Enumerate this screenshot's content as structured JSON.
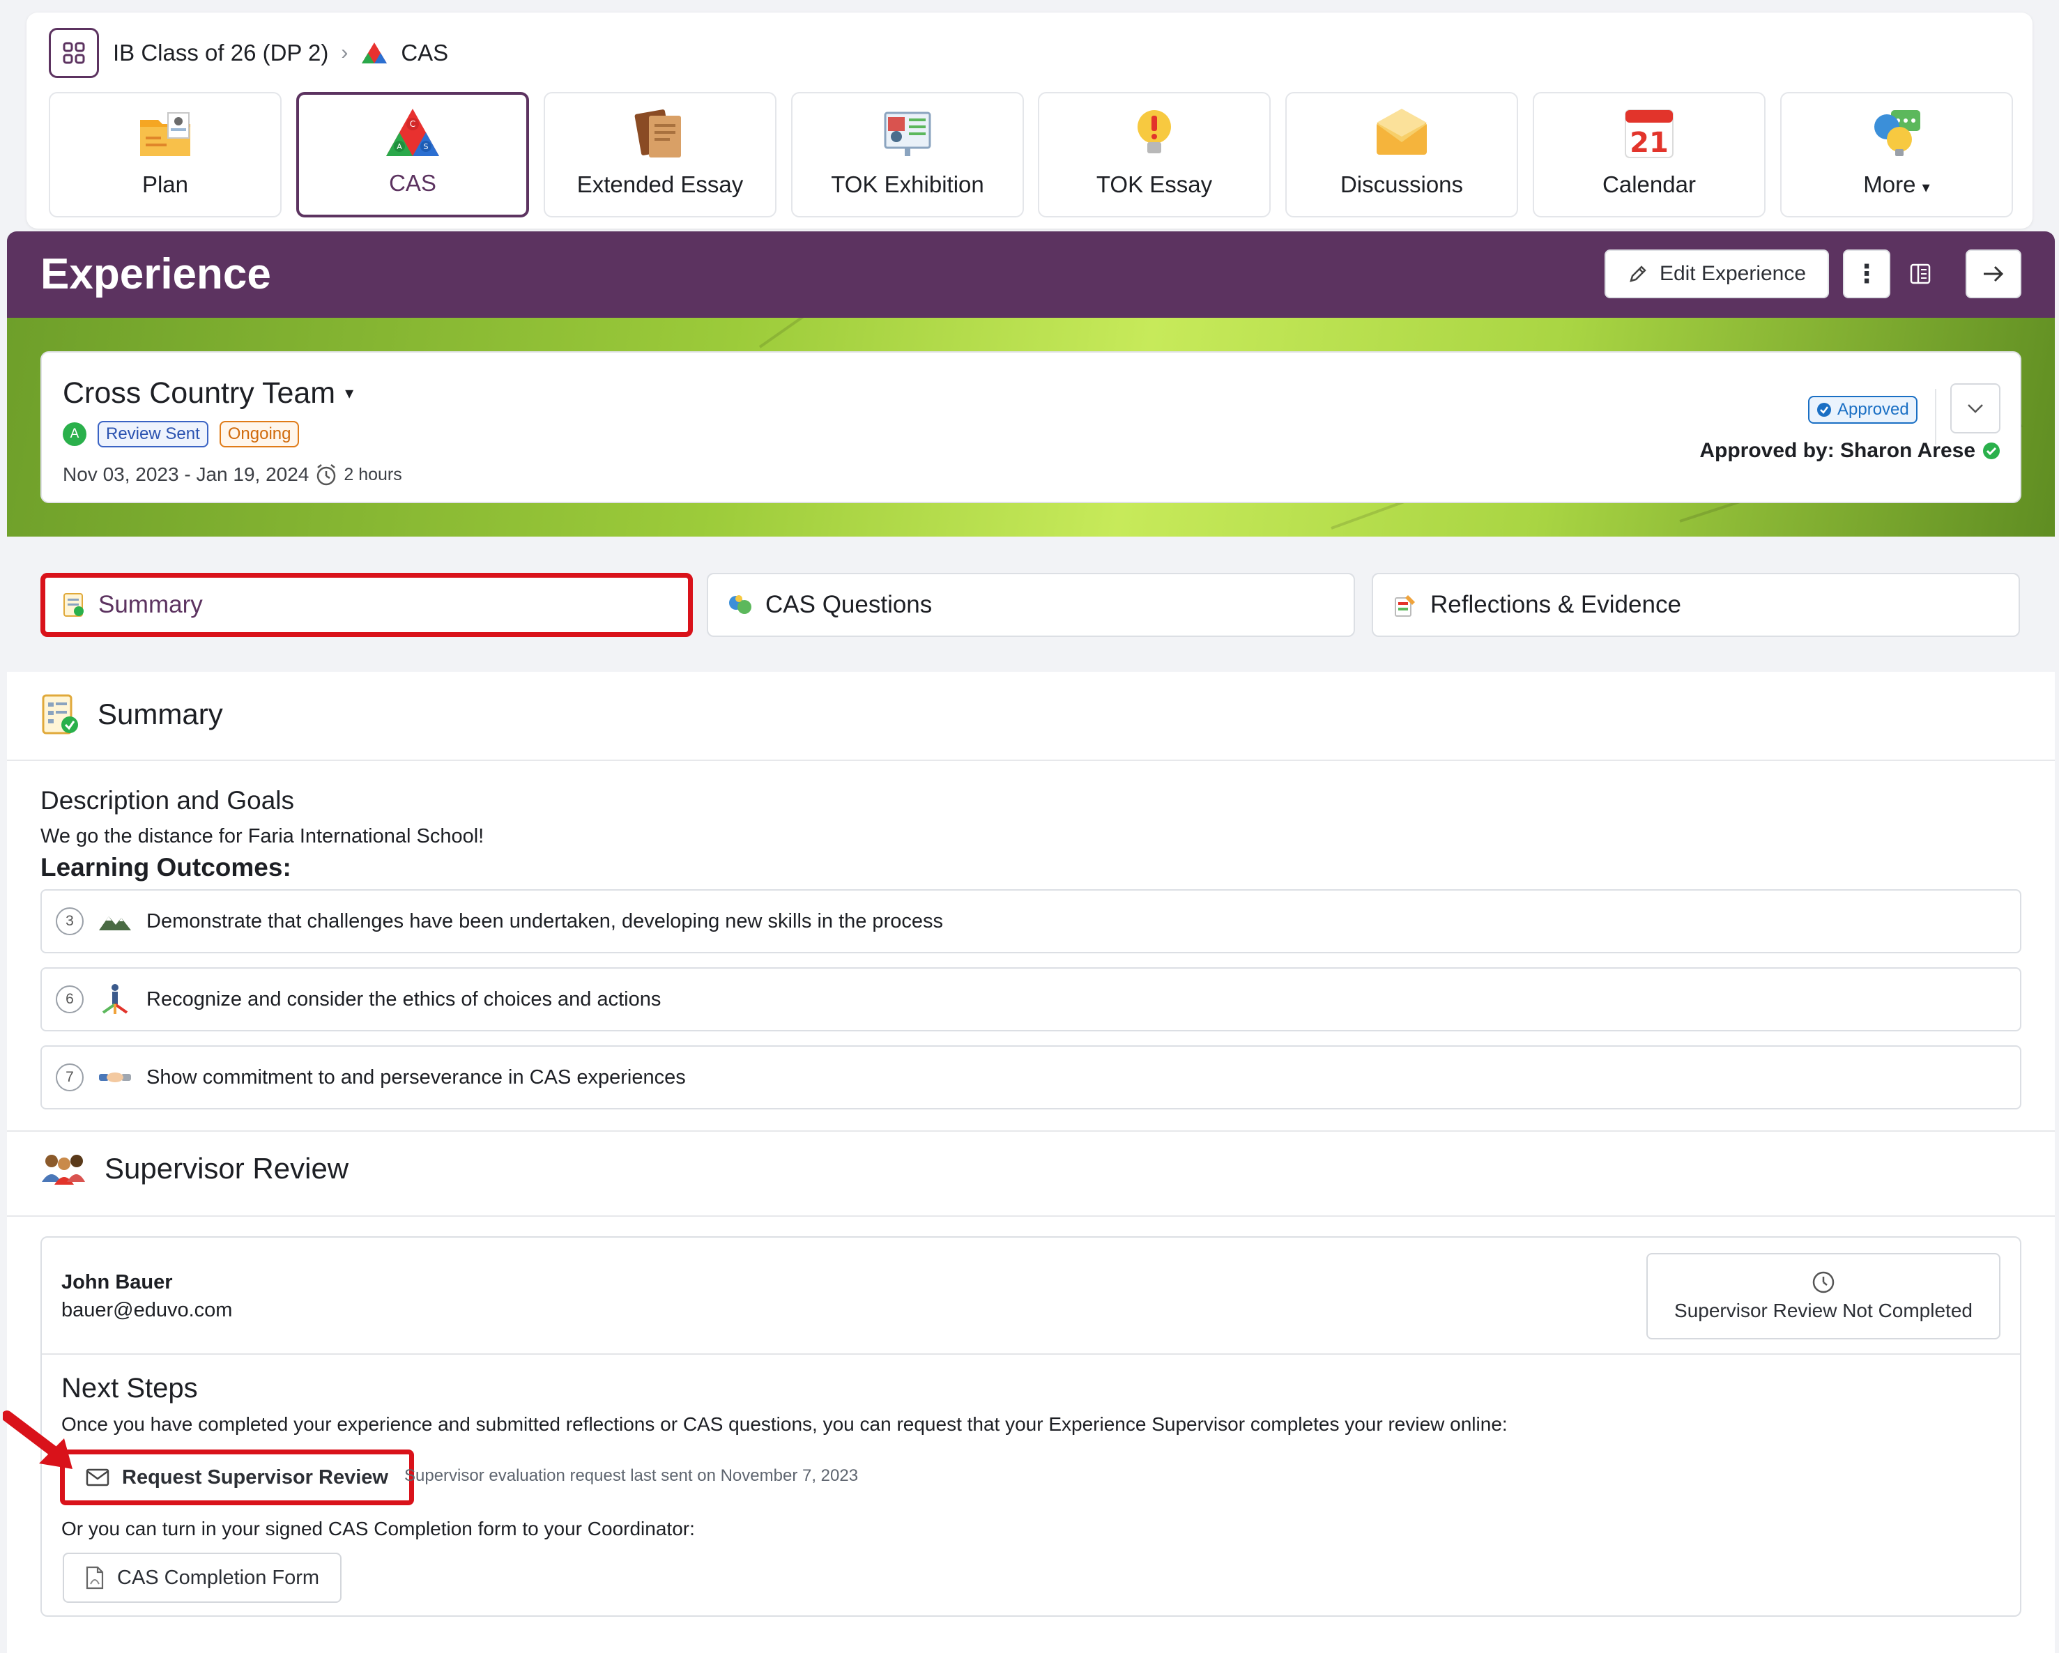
{
  "breadcrumb": {
    "class_name": "IB Class of 26 (DP 2)",
    "current": "CAS"
  },
  "nav": [
    {
      "label": "Plan",
      "icon": "plan-icon"
    },
    {
      "label": "CAS",
      "icon": "cas-icon",
      "active": true
    },
    {
      "label": "Extended Essay",
      "icon": "extended-essay-icon"
    },
    {
      "label": "TOK Exhibition",
      "icon": "tok-exhibition-icon"
    },
    {
      "label": "TOK Essay",
      "icon": "tok-essay-icon"
    },
    {
      "label": "Discussions",
      "icon": "discussions-icon"
    },
    {
      "label": "Calendar",
      "icon": "calendar-icon",
      "calendar_day": "21"
    },
    {
      "label": "More",
      "icon": "more-icon"
    }
  ],
  "header": {
    "title": "Experience",
    "edit_label": "Edit Experience"
  },
  "experience": {
    "name": "Cross Country Team",
    "category_letter": "A",
    "badges": [
      "Review Sent",
      "Ongoing"
    ],
    "dates": "Nov 03, 2023 - Jan 19, 2024",
    "duration": "2 hours",
    "status": "Approved",
    "approved_by": "Approved by: Sharon Arese"
  },
  "tabs": [
    "Summary",
    "CAS Questions",
    "Reflections & Evidence"
  ],
  "summary": {
    "heading": "Summary",
    "desc_heading": "Description and Goals",
    "desc_text": "We go the distance for Faria International School!",
    "lo_heading": "Learning Outcomes:",
    "outcomes": [
      {
        "num": "3",
        "text": "Demonstrate that challenges have been undertaken, developing new skills in the process"
      },
      {
        "num": "6",
        "text": "Recognize and consider the ethics of choices and actions"
      },
      {
        "num": "7",
        "text": "Show commitment to and perseverance in CAS experiences"
      }
    ]
  },
  "supervisor": {
    "heading": "Supervisor Review",
    "name": "John Bauer",
    "email": "bauer@eduvo.com",
    "status": "Supervisor Review Not Completed",
    "next_steps_heading": "Next Steps",
    "next_steps_text": "Once you have completed your experience and submitted reflections or CAS questions, you can request that your Experience Supervisor completes your review online:",
    "request_label": "Request Supervisor Review",
    "last_sent": "Supervisor evaluation request last sent on November 7, 2023",
    "or_text": "Or you can turn in your signed CAS Completion form to your Coordinator:",
    "form_label": "CAS Completion Form"
  },
  "colors": {
    "brand_purple": "#5c3360",
    "highlight_red": "#d9121a",
    "approved_blue": "#1a6fc4",
    "ongoing_orange": "#e07b18"
  }
}
